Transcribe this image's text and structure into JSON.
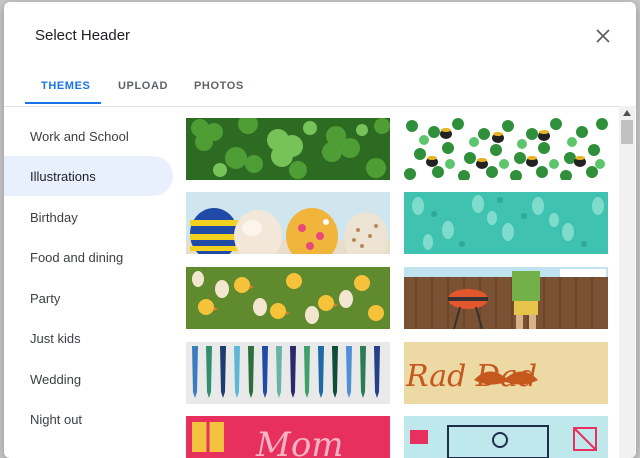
{
  "dialog": {
    "title": "Select Header",
    "close_icon": "close-icon"
  },
  "tabs": [
    {
      "label": "THEMES",
      "active": true
    },
    {
      "label": "UPLOAD",
      "active": false
    },
    {
      "label": "PHOTOS",
      "active": false
    }
  ],
  "categories": [
    {
      "label": "Work and School",
      "selected": false
    },
    {
      "label": "Illustrations",
      "selected": true
    },
    {
      "label": "Birthday",
      "selected": false
    },
    {
      "label": "Food and dining",
      "selected": false
    },
    {
      "label": "Party",
      "selected": false
    },
    {
      "label": "Just kids",
      "selected": false
    },
    {
      "label": "Wedding",
      "selected": false
    },
    {
      "label": "Night out",
      "selected": false
    }
  ],
  "thumbnails": [
    {
      "name": "clover-leaves"
    },
    {
      "name": "pots-of-gold-pattern"
    },
    {
      "name": "easter-eggs"
    },
    {
      "name": "teal-bunny-pattern"
    },
    {
      "name": "chicks-and-eggs"
    },
    {
      "name": "grill-fence"
    },
    {
      "name": "neckties"
    },
    {
      "name": "rad-dad-mustache",
      "text": "Rad Dad"
    },
    {
      "name": "mom-lettering",
      "text": "Mom"
    },
    {
      "name": "kitchen-illustration"
    }
  ],
  "colors": {
    "accent": "#1a73e8",
    "selected_bg": "#e8f0fe"
  }
}
